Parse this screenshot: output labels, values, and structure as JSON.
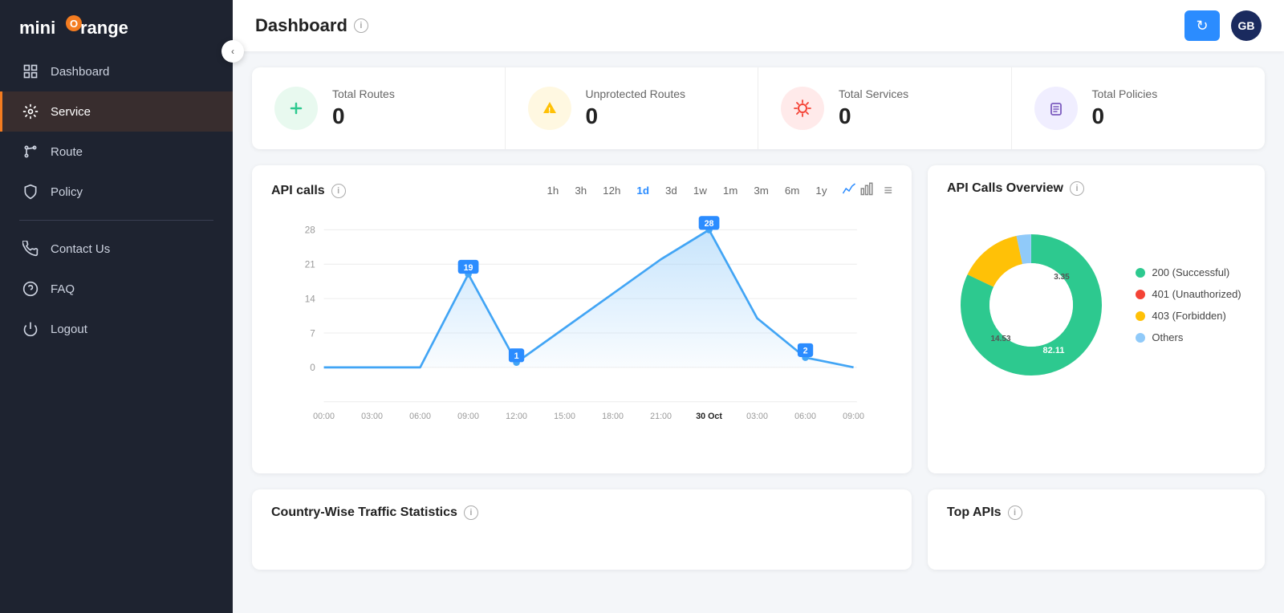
{
  "sidebar": {
    "logo": "mini",
    "logo_accent": "O",
    "logo_rest": "range",
    "nav_items": [
      {
        "id": "dashboard",
        "label": "Dashboard",
        "active": false,
        "icon": "grid"
      },
      {
        "id": "service",
        "label": "Service",
        "active": true,
        "icon": "settings"
      },
      {
        "id": "route",
        "label": "Route",
        "active": false,
        "icon": "fork"
      },
      {
        "id": "policy",
        "label": "Policy",
        "active": false,
        "icon": "shield"
      }
    ],
    "bottom_items": [
      {
        "id": "contact",
        "label": "Contact Us",
        "icon": "phone"
      },
      {
        "id": "faq",
        "label": "FAQ",
        "icon": "help"
      },
      {
        "id": "logout",
        "label": "Logout",
        "icon": "power"
      }
    ]
  },
  "topbar": {
    "title": "Dashboard",
    "avatar": "GB",
    "refresh_label": "↻"
  },
  "stats": [
    {
      "id": "total-routes",
      "label": "Total Routes",
      "value": "0",
      "color": "green",
      "icon": "+"
    },
    {
      "id": "unprotected-routes",
      "label": "Unprotected Routes",
      "value": "0",
      "color": "yellow",
      "icon": "⚠"
    },
    {
      "id": "total-services",
      "label": "Total Services",
      "value": "0",
      "color": "red",
      "icon": "⚙"
    },
    {
      "id": "total-policies",
      "label": "Total Policies",
      "value": "0",
      "color": "purple",
      "icon": "📋"
    }
  ],
  "api_calls_chart": {
    "title": "API calls",
    "time_filters": [
      "1h",
      "3h",
      "12h",
      "1d",
      "3d",
      "1w",
      "1m",
      "3m",
      "6m",
      "1y"
    ],
    "active_filter": "1d",
    "menu_icon": "≡",
    "y_labels": [
      "28",
      "21",
      "14",
      "7",
      "0"
    ],
    "x_labels": [
      "00:00",
      "03:00",
      "06:00",
      "09:00",
      "12:00",
      "15:00",
      "18:00",
      "21:00",
      "30 Oct",
      "03:00",
      "06:00",
      "09:00"
    ],
    "data_points": [
      {
        "x": 0,
        "y": 0,
        "label": ""
      },
      {
        "x": 1,
        "y": 0,
        "label": ""
      },
      {
        "x": 2,
        "y": 0,
        "label": ""
      },
      {
        "x": 3,
        "y": 19,
        "label": "19"
      },
      {
        "x": 4,
        "y": 1,
        "label": "1"
      },
      {
        "x": 5,
        "y": 8,
        "label": ""
      },
      {
        "x": 6,
        "y": 15,
        "label": ""
      },
      {
        "x": 7,
        "y": 22,
        "label": ""
      },
      {
        "x": 8,
        "y": 28,
        "label": "28"
      },
      {
        "x": 9,
        "y": 10,
        "label": ""
      },
      {
        "x": 10,
        "y": 2,
        "label": "2"
      },
      {
        "x": 11,
        "y": 0,
        "label": ""
      }
    ]
  },
  "api_overview_chart": {
    "title": "API Calls Overview",
    "segments": [
      {
        "label": "200 (Successful)",
        "value": 82.11,
        "color": "#2dc98f"
      },
      {
        "label": "401 (Unauthorized)",
        "value": 0,
        "color": "#f44336"
      },
      {
        "label": "403 (Forbidden)",
        "value": 14.53,
        "color": "#ffc107"
      },
      {
        "label": "Others",
        "value": 3.35,
        "color": "#90caf9"
      }
    ],
    "center_label": ""
  },
  "country_traffic": {
    "title": "Country-Wise Traffic Statistics"
  },
  "top_apis": {
    "title": "Top APIs"
  }
}
